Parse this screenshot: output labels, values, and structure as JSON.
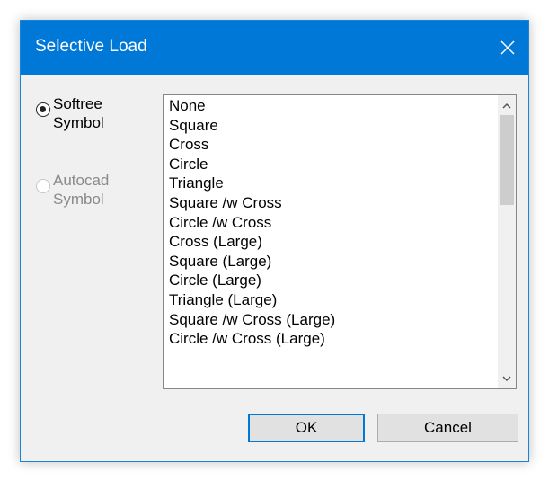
{
  "window": {
    "title": "Selective Load",
    "close_icon": "close-icon",
    "accent_color": "#0078d7"
  },
  "radio_options": [
    {
      "label": "Softree\nSymbol",
      "selected": true,
      "enabled": true
    },
    {
      "label": "Autocad\nSymbol",
      "selected": false,
      "enabled": false
    }
  ],
  "symbol_list": {
    "items": [
      "None",
      "Square",
      "Cross",
      "Circle",
      "Triangle",
      "Square /w Cross",
      "Circle /w Cross",
      "Cross (Large)",
      "Square (Large)",
      "Circle (Large)",
      "Triangle (Large)",
      "Square /w Cross (Large)",
      "Circle /w Cross (Large)"
    ],
    "scroll_up_icon": "chevron-up-icon",
    "scroll_down_icon": "chevron-down-icon"
  },
  "buttons": {
    "ok_label": "OK",
    "cancel_label": "Cancel"
  }
}
